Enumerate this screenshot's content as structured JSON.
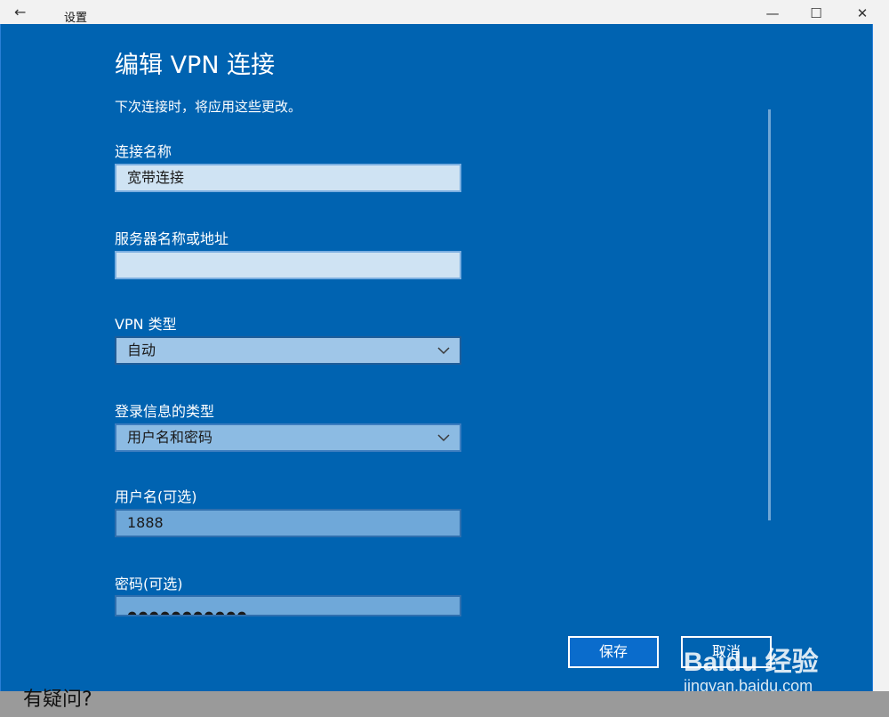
{
  "titlebar": {
    "back_glyph": "←",
    "title": "设置",
    "minimize_glyph": "—",
    "maximize_glyph": "☐",
    "close_glyph": "✕"
  },
  "dialog": {
    "title": "编辑 VPN 连接",
    "subtitle": "下次连接时，将应用这些更改。",
    "fields": {
      "connection_name": {
        "label": "连接名称",
        "value": "宽带连接"
      },
      "server": {
        "label": "服务器名称或地址",
        "value": ""
      },
      "vpn_type": {
        "label": "VPN 类型",
        "value": "自动"
      },
      "signin_type": {
        "label": "登录信息的类型",
        "value": "用户名和密码"
      },
      "username": {
        "label": "用户名(可选)",
        "value": "1888"
      },
      "password": {
        "label": "密码(可选)",
        "value": "●●●●●●●●●●●"
      }
    },
    "buttons": {
      "save": "保存",
      "cancel": "取消"
    }
  },
  "footer": {
    "question": "有疑问?"
  },
  "watermark": {
    "logo": "Baidu 经验",
    "url": "jingyan.baidu.com"
  },
  "colors": {
    "dialog_bg": "#0063b1",
    "accent_border": "#ffffff"
  },
  "icons": [
    "back-arrow-icon",
    "minimize-icon",
    "maximize-icon",
    "close-icon",
    "chevron-down-icon"
  ]
}
